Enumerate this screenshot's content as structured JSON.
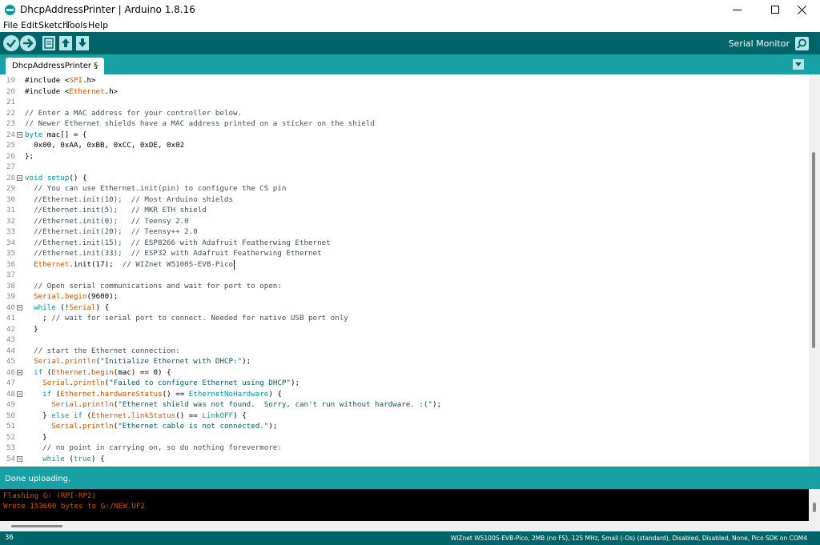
{
  "window": {
    "title": "DhcpAddressPrinter | Arduino 1.8.16",
    "controls": {
      "minimize": "minimize",
      "maximize": "maximize",
      "close": "close"
    }
  },
  "menu": [
    "File",
    "Edit",
    "Sketch",
    "Tools",
    "Help"
  ],
  "toolbar": {
    "buttons": [
      "verify-icon",
      "upload-icon",
      "new-icon",
      "open-icon",
      "save-icon"
    ],
    "serial_monitor_label": "Serial Monitor",
    "serial_monitor_icon": "magnifier-icon"
  },
  "tabs": [
    {
      "label": "DhcpAddressPrinter §"
    }
  ],
  "editor": {
    "lines": [
      {
        "n": "19",
        "fold": false,
        "segs": [
          [
            "pp",
            "#include <"
          ],
          [
            "cl",
            "SPI"
          ],
          [
            "pp",
            ".h>"
          ]
        ]
      },
      {
        "n": "20",
        "fold": false,
        "segs": [
          [
            "pp",
            "#include <"
          ],
          [
            "cl",
            "Ethernet"
          ],
          [
            "pp",
            ".h>"
          ]
        ]
      },
      {
        "n": "21",
        "fold": false,
        "segs": []
      },
      {
        "n": "22",
        "fold": false,
        "segs": [
          [
            "cm",
            "// Enter a MAC address for your controller below."
          ]
        ]
      },
      {
        "n": "23",
        "fold": false,
        "segs": [
          [
            "cm",
            "// Newer Ethernet shields have a MAC address printed on a sticker on the shield"
          ]
        ]
      },
      {
        "n": "24",
        "fold": true,
        "segs": [
          [
            "kw",
            "byte"
          ],
          [
            "tx",
            " mac[] = {"
          ]
        ]
      },
      {
        "n": "25",
        "fold": false,
        "segs": [
          [
            "tx",
            "  0x00, 0xAA, 0xBB, 0xCC, 0xDE, 0x02"
          ]
        ]
      },
      {
        "n": "26",
        "fold": false,
        "segs": [
          [
            "tx",
            "};"
          ]
        ]
      },
      {
        "n": "27",
        "fold": false,
        "segs": []
      },
      {
        "n": "28",
        "fold": true,
        "segs": [
          [
            "kw",
            "void"
          ],
          [
            "tx",
            " "
          ],
          [
            "kw",
            "setup"
          ],
          [
            "tx",
            "() {"
          ]
        ]
      },
      {
        "n": "29",
        "fold": false,
        "segs": [
          [
            "cm",
            "  // You can use Ethernet.init(pin) to configure the CS pin"
          ]
        ]
      },
      {
        "n": "30",
        "fold": false,
        "segs": [
          [
            "cm",
            "  //Ethernet.init(10);  // Most Arduino shields"
          ]
        ]
      },
      {
        "n": "31",
        "fold": false,
        "segs": [
          [
            "cm",
            "  //Ethernet.init(5);   // MKR ETH shield"
          ]
        ]
      },
      {
        "n": "32",
        "fold": false,
        "segs": [
          [
            "cm",
            "  //Ethernet.init(0);   // Teensy 2.0"
          ]
        ]
      },
      {
        "n": "33",
        "fold": false,
        "segs": [
          [
            "cm",
            "  //Ethernet.init(20);  // Teensy++ 2.0"
          ]
        ]
      },
      {
        "n": "34",
        "fold": false,
        "segs": [
          [
            "cm",
            "  //Ethernet.init(15);  // ESP8266 with Adafruit Featherwing Ethernet"
          ]
        ]
      },
      {
        "n": "35",
        "fold": false,
        "segs": [
          [
            "cm",
            "  //Ethernet.init(33);  // ESP32 with Adafruit Featherwing Ethernet"
          ]
        ]
      },
      {
        "n": "36",
        "fold": false,
        "segs": [
          [
            "tx",
            "  "
          ],
          [
            "cl",
            "Ethernet"
          ],
          [
            "tx",
            ".init(17);  "
          ],
          [
            "cm",
            "// WIZnet W5100S-EVB-Pico"
          ]
        ]
      },
      {
        "n": "37",
        "fold": false,
        "segs": []
      },
      {
        "n": "38",
        "fold": false,
        "segs": [
          [
            "cm",
            "  // Open serial communications and wait for port to open:"
          ]
        ]
      },
      {
        "n": "39",
        "fold": false,
        "segs": [
          [
            "tx",
            "  "
          ],
          [
            "cl",
            "Serial"
          ],
          [
            "tx",
            "."
          ],
          [
            "cl",
            "begin"
          ],
          [
            "tx",
            "(9600);"
          ]
        ]
      },
      {
        "n": "40",
        "fold": true,
        "segs": [
          [
            "tx",
            "  "
          ],
          [
            "kw",
            "while"
          ],
          [
            "tx",
            " (!"
          ],
          [
            "cl",
            "Serial"
          ],
          [
            "tx",
            ") {"
          ]
        ]
      },
      {
        "n": "41",
        "fold": false,
        "segs": [
          [
            "tx",
            "    ; "
          ],
          [
            "cm",
            "// wait for serial port to connect. Needed for native USB port only"
          ]
        ]
      },
      {
        "n": "42",
        "fold": false,
        "segs": [
          [
            "tx",
            "  }"
          ]
        ]
      },
      {
        "n": "43",
        "fold": false,
        "segs": []
      },
      {
        "n": "44",
        "fold": false,
        "segs": [
          [
            "cm",
            "  // start the Ethernet connection:"
          ]
        ]
      },
      {
        "n": "45",
        "fold": false,
        "segs": [
          [
            "tx",
            "  "
          ],
          [
            "cl",
            "Serial"
          ],
          [
            "tx",
            "."
          ],
          [
            "cl",
            "println"
          ],
          [
            "tx",
            "("
          ],
          [
            "st",
            "\"Initialize Ethernet with DHCP:\""
          ],
          [
            "tx",
            ");"
          ]
        ]
      },
      {
        "n": "46",
        "fold": true,
        "segs": [
          [
            "tx",
            "  "
          ],
          [
            "kw",
            "if"
          ],
          [
            "tx",
            " ("
          ],
          [
            "cl",
            "Ethernet"
          ],
          [
            "tx",
            "."
          ],
          [
            "cl",
            "begin"
          ],
          [
            "tx",
            "(mac) == 0) {"
          ]
        ]
      },
      {
        "n": "47",
        "fold": false,
        "segs": [
          [
            "tx",
            "    "
          ],
          [
            "cl",
            "Serial"
          ],
          [
            "tx",
            "."
          ],
          [
            "cl",
            "println"
          ],
          [
            "tx",
            "("
          ],
          [
            "st",
            "\"Failed to configure Ethernet using DHCP\""
          ],
          [
            "tx",
            ");"
          ]
        ]
      },
      {
        "n": "48",
        "fold": true,
        "segs": [
          [
            "tx",
            "    "
          ],
          [
            "kw",
            "if"
          ],
          [
            "tx",
            " ("
          ],
          [
            "cl",
            "Ethernet"
          ],
          [
            "tx",
            "."
          ],
          [
            "cl",
            "hardwareStatus"
          ],
          [
            "tx",
            "() == "
          ],
          [
            "ct",
            "EthernetNoHardware"
          ],
          [
            "tx",
            ") {"
          ]
        ]
      },
      {
        "n": "49",
        "fold": false,
        "segs": [
          [
            "tx",
            "      "
          ],
          [
            "cl",
            "Serial"
          ],
          [
            "tx",
            "."
          ],
          [
            "cl",
            "println"
          ],
          [
            "tx",
            "("
          ],
          [
            "st",
            "\"Ethernet shield was not found.  Sorry, can't run without hardware. :(\""
          ],
          [
            "tx",
            ");"
          ]
        ]
      },
      {
        "n": "50",
        "fold": false,
        "segs": [
          [
            "tx",
            "    } "
          ],
          [
            "kw",
            "else"
          ],
          [
            "tx",
            " "
          ],
          [
            "kw",
            "if"
          ],
          [
            "tx",
            " ("
          ],
          [
            "cl",
            "Ethernet"
          ],
          [
            "tx",
            "."
          ],
          [
            "cl",
            "linkStatus"
          ],
          [
            "tx",
            "() == "
          ],
          [
            "ct",
            "LinkOFF"
          ],
          [
            "tx",
            ") {"
          ]
        ]
      },
      {
        "n": "51",
        "fold": false,
        "segs": [
          [
            "tx",
            "      "
          ],
          [
            "cl",
            "Serial"
          ],
          [
            "tx",
            "."
          ],
          [
            "cl",
            "println"
          ],
          [
            "tx",
            "("
          ],
          [
            "st",
            "\"Ethernet cable is not connected.\""
          ],
          [
            "tx",
            ");"
          ]
        ]
      },
      {
        "n": "52",
        "fold": false,
        "segs": [
          [
            "tx",
            "    }"
          ]
        ]
      },
      {
        "n": "53",
        "fold": false,
        "segs": [
          [
            "cm",
            "    // no point in carrying on, so do nothing forevermore:"
          ]
        ]
      },
      {
        "n": "54",
        "fold": true,
        "segs": [
          [
            "tx",
            "    "
          ],
          [
            "kw",
            "while"
          ],
          [
            "tx",
            " ("
          ],
          [
            "kw",
            "true"
          ],
          [
            "tx",
            ") {"
          ]
        ]
      }
    ],
    "caret_line": "36"
  },
  "status": {
    "text": "Done uploading."
  },
  "console": {
    "lines": [
      "Flashing G: (RPI-RP2)",
      "Wrote 153600 bytes to G:/NEW.UF2"
    ]
  },
  "footer": {
    "line": "36",
    "board": "WIZnet W5100S-EVB-Pico, 2MB (no FS), 125 MHz, Small (-Os) (standard), Disabled, Disabled, None, Pico SDK on COM4"
  },
  "colors": {
    "toolbar": "#006468",
    "tabbar": "#17a1a5",
    "keyword": "#00979c",
    "class": "#d35400",
    "comment": "#434f54",
    "string": "#005c5f",
    "console_text": "#d35400"
  }
}
